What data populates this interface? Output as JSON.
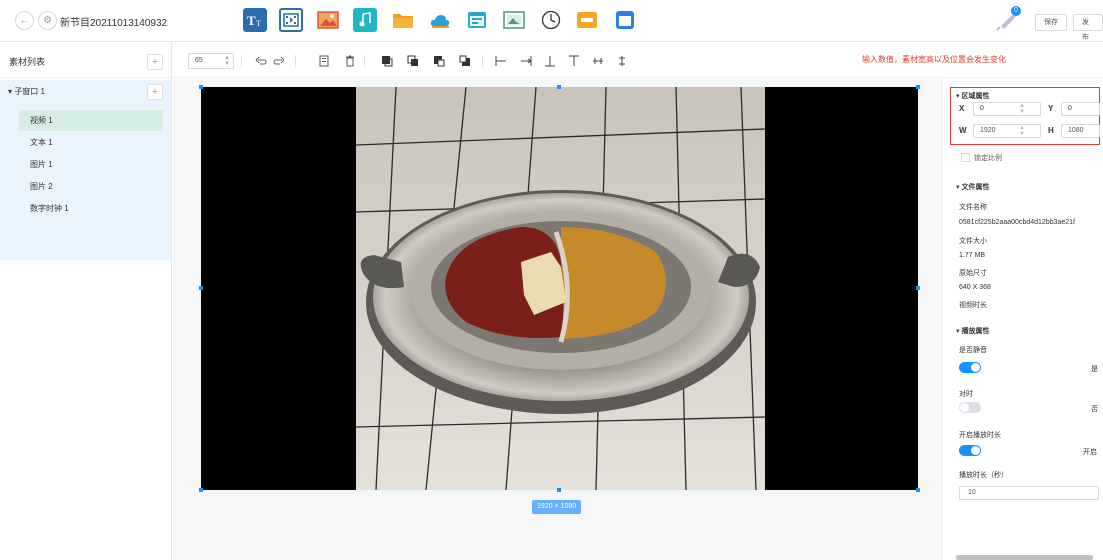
{
  "header": {
    "title": "新节目20211013140932",
    "save_label": "保存",
    "publish_label": "发布",
    "notification_count": "0"
  },
  "left_panel": {
    "title": "素材列表",
    "group_label": "▾ 子窗口 1",
    "items": [
      {
        "label": "视频 1",
        "selected": true
      },
      {
        "label": "文本 1",
        "selected": false
      },
      {
        "label": "图片 1",
        "selected": false
      },
      {
        "label": "图片 2",
        "selected": false
      },
      {
        "label": "数字时钟 1",
        "selected": false
      }
    ]
  },
  "toolbar": {
    "zoom_value": "65",
    "hint_text": "输入数值，素材宽高以及位置会发生变化"
  },
  "canvas": {
    "size_label": "1920 × 1080"
  },
  "right_panel": {
    "area_title": "▾ 区域属性",
    "x_label": "X",
    "x_value": "0",
    "y_label": "Y",
    "y_value": "0",
    "w_label": "W",
    "w_value": "1920",
    "h_label": "H",
    "h_value": "1080",
    "lock_ratio_label": "锁定比例",
    "file_title": "▾ 文件属性",
    "file_name_label": "文件名称",
    "file_name_value": "0581cf225b2aaa00cbd4d12bb3ae21f",
    "file_size_label": "文件大小",
    "file_size_value": "1.77 MB",
    "orig_size_label": "原始尺寸",
    "orig_size_value": "640 X 368",
    "video_duration_label": "视频时长",
    "play_title": "▾ 播放属性",
    "mute_label": "是否静音",
    "mute_value": "是",
    "mute_on": true,
    "sync_label": "对时",
    "sync_value": "否",
    "sync_on": false,
    "enable_duration_label": "开启播放时长",
    "enable_duration_value": "开启",
    "enable_duration_on": true,
    "duration_label": "播放时长（秒）",
    "duration_value": "10"
  }
}
